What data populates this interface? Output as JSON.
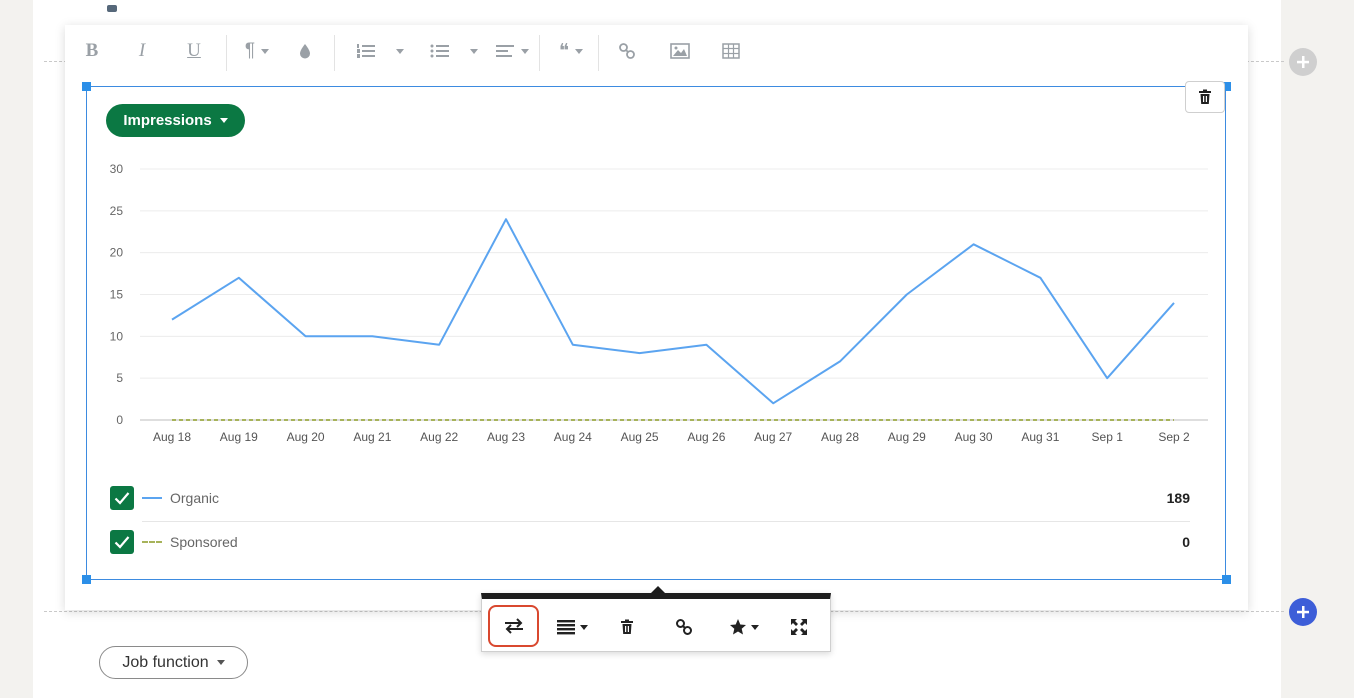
{
  "toolbar": {
    "bold": "B",
    "italic": "I",
    "underline": "U",
    "paragraph": "¶",
    "quote": "❝"
  },
  "metric_button": {
    "label": "Impressions"
  },
  "chart_data": {
    "type": "line",
    "categories": [
      "Aug 18",
      "Aug 19",
      "Aug 20",
      "Aug 21",
      "Aug 22",
      "Aug 23",
      "Aug 24",
      "Aug 25",
      "Aug 26",
      "Aug 27",
      "Aug 28",
      "Aug 29",
      "Aug 30",
      "Aug 31",
      "Sep 1",
      "Sep 2"
    ],
    "y_ticks": [
      0,
      5,
      10,
      15,
      20,
      25,
      30
    ],
    "ylim": [
      0,
      30
    ],
    "grid": true,
    "series": [
      {
        "name": "Organic",
        "values": [
          12,
          17,
          10,
          10,
          9,
          24,
          9,
          8,
          9,
          2,
          7,
          15,
          21,
          17,
          5,
          14
        ],
        "color": "#5ba4f0",
        "style": "solid"
      },
      {
        "name": "Sponsored",
        "values": [
          0,
          0,
          0,
          0,
          0,
          0,
          0,
          0,
          0,
          0,
          0,
          0,
          0,
          0,
          0,
          0
        ],
        "color": "#a7b35a",
        "style": "dashed"
      }
    ]
  },
  "legend": {
    "items": [
      {
        "label": "Organic",
        "total": "189",
        "color": "#5ba4f0"
      },
      {
        "label": "Sponsored",
        "total": "0",
        "color": "#a7b35a"
      }
    ]
  },
  "colors": {
    "accent_green": "#0b7843",
    "selection_blue": "#2c8fe8",
    "highlight_red": "#d9482f",
    "add_blue": "#3d5ed8"
  },
  "filter": {
    "label": "Job function"
  }
}
